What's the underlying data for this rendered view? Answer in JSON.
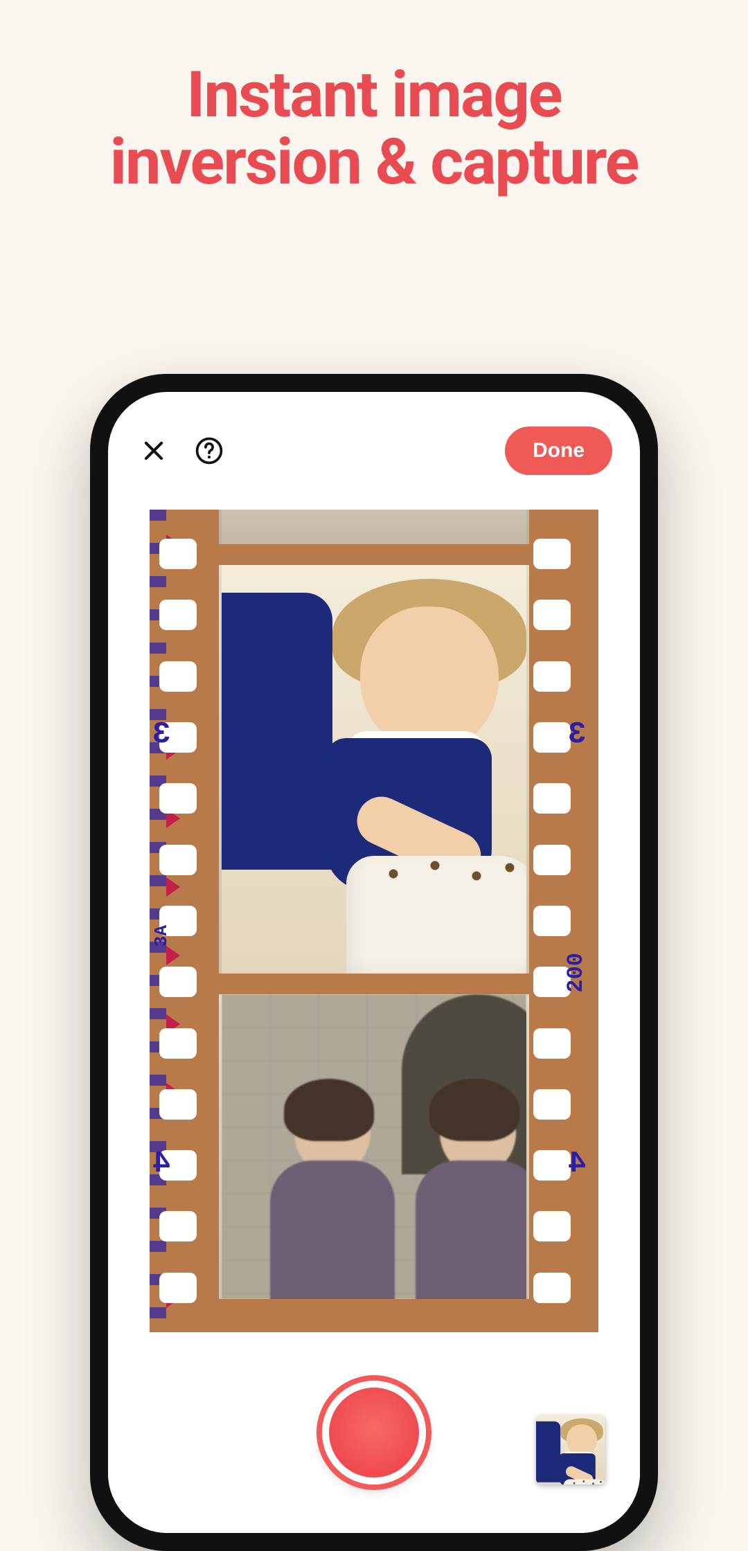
{
  "headline": {
    "line1": "Instant image",
    "line2": "inversion & capture"
  },
  "topbar": {
    "close_icon": "close",
    "help_icon": "help",
    "done_label": "Done"
  },
  "film": {
    "frame_numbers": {
      "three": "3",
      "four": "4",
      "iso": "200",
      "three_a": "3A"
    }
  },
  "capture": {
    "shutter_name": "shutter",
    "thumbnail_name": "last-capture-thumbnail"
  }
}
